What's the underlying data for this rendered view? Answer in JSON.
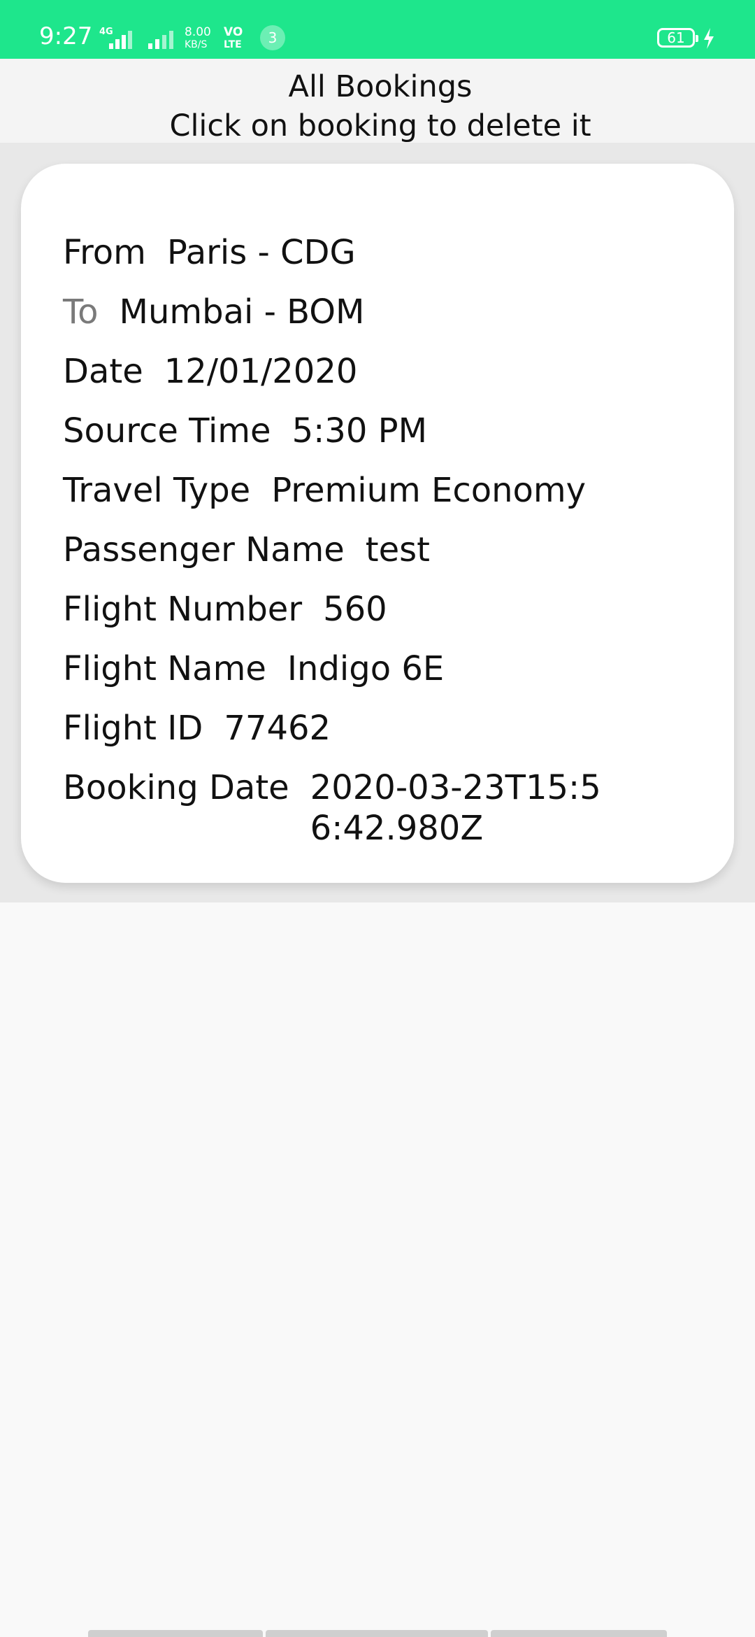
{
  "status_bar": {
    "time": "9:27",
    "network_label": "4G",
    "speed_value": "8.00",
    "speed_unit": "KB/S",
    "volte_top": "VO",
    "volte_bottom": "LTE",
    "notification_count": "3",
    "battery_level": "61",
    "icons": [
      "signal-icon",
      "signal-icon-2",
      "charging-bolt-icon"
    ],
    "bar_color": "#1ee68c"
  },
  "header": {
    "title": "All Bookings",
    "subtitle": "Click on booking to delete it"
  },
  "booking": {
    "from_label": "From",
    "from_value": "Paris - CDG",
    "to_label": "To",
    "to_value": "Mumbai - BOM",
    "date_label": "Date",
    "date_value": "12/01/2020",
    "source_time_label": "Source Time",
    "source_time_value": "5:30 PM",
    "travel_type_label": "Travel Type",
    "travel_type_value": "Premium Economy",
    "passenger_label": "Passenger Name",
    "passenger_value": "test",
    "flight_number_label": "Flight Number",
    "flight_number_value": "560",
    "flight_name_label": "Flight Name",
    "flight_name_value": "Indigo 6E",
    "flight_id_label": "Flight ID",
    "flight_id_value": "77462",
    "booking_date_label": "Booking Date",
    "booking_date_value": "2020-03-23T15:56:42.980Z"
  }
}
